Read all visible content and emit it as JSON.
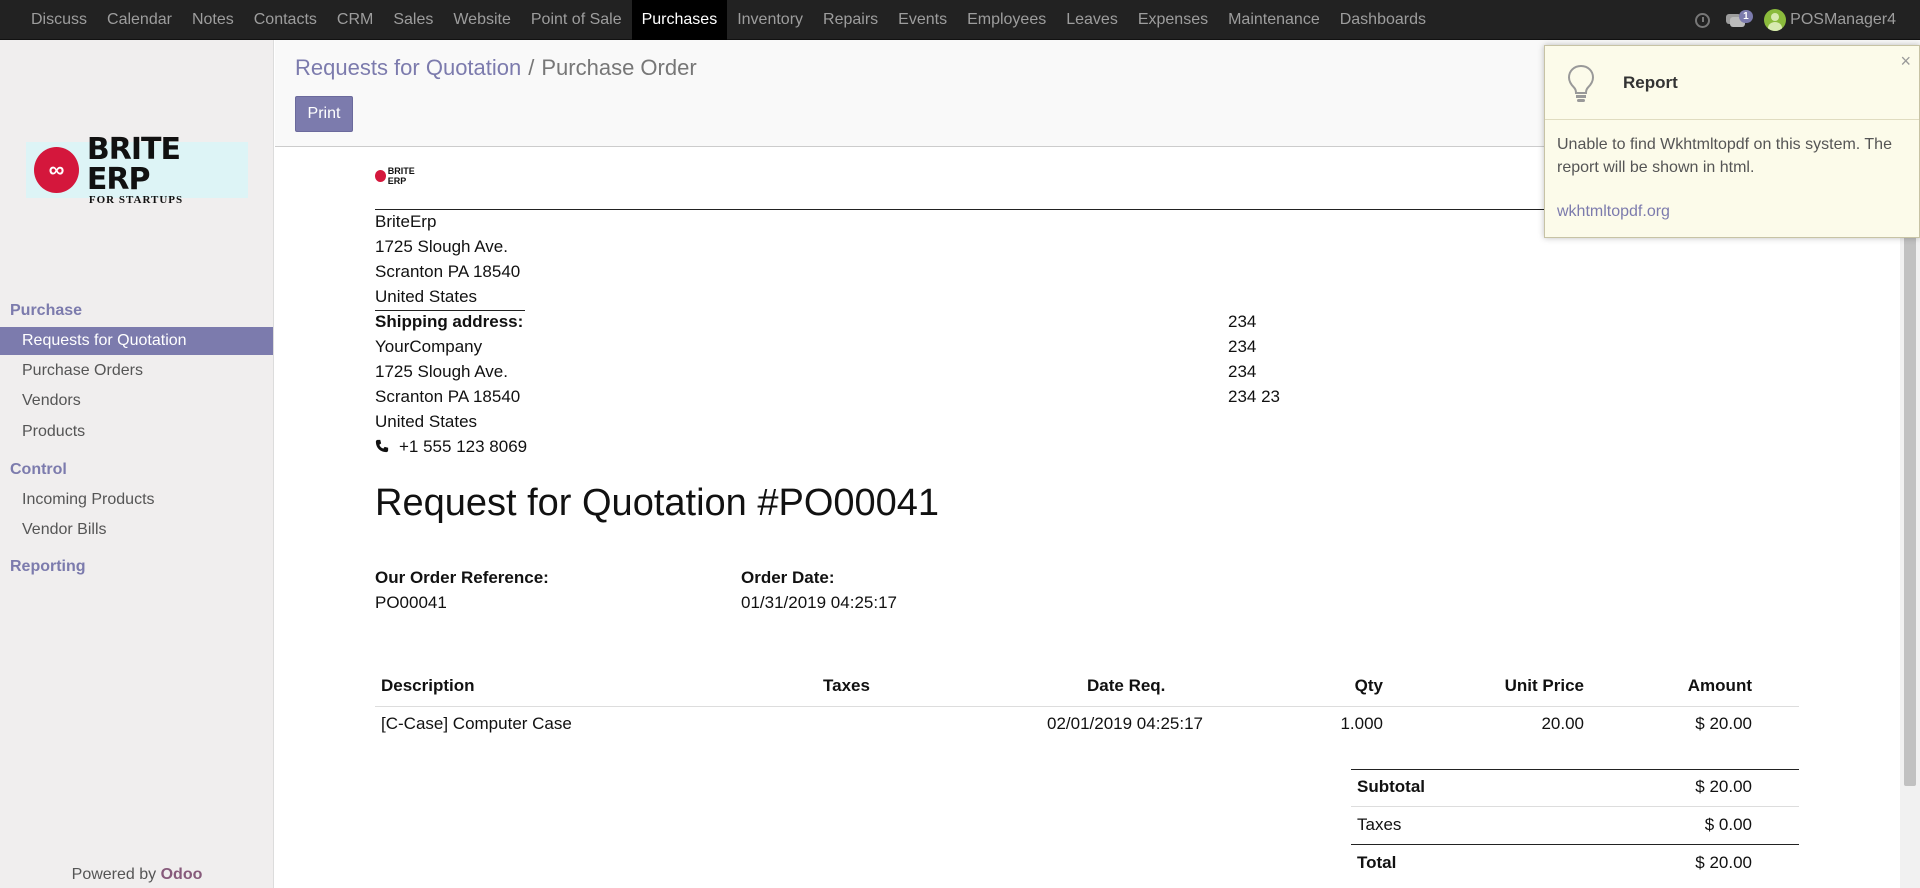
{
  "topbar": {
    "menu": [
      "Discuss",
      "Calendar",
      "Notes",
      "Contacts",
      "CRM",
      "Sales",
      "Website",
      "Point of Sale",
      "Purchases",
      "Inventory",
      "Repairs",
      "Events",
      "Employees",
      "Leaves",
      "Expenses",
      "Maintenance",
      "Dashboards"
    ],
    "active": "Purchases",
    "chat_badge": "1",
    "user": "POSManager4"
  },
  "logo": {
    "line1": "BRITE ERP",
    "line2": "FOR STARTUPS",
    "mini": "BRITE ERP"
  },
  "sidebar": {
    "sections": [
      {
        "title": "Purchase",
        "items": [
          "Requests for Quotation",
          "Purchase Orders",
          "Vendors",
          "Products"
        ]
      },
      {
        "title": "Control",
        "items": [
          "Incoming Products",
          "Vendor Bills"
        ]
      },
      {
        "title": "Reporting",
        "items": []
      }
    ],
    "active_item": "Requests for Quotation",
    "powered_prefix": "Powered by",
    "powered_brand": "Odoo"
  },
  "breadcrumb": {
    "parent": "Requests for Quotation",
    "separator": "/",
    "current": "Purchase Order"
  },
  "buttons": {
    "print": "Print"
  },
  "report": {
    "company": {
      "name": "BriteErp",
      "street": "1725 Slough Ave.",
      "city": "Scranton PA 18540",
      "country": "United States"
    },
    "shipping_label": "Shipping address:",
    "shipping": {
      "name": "YourCompany",
      "street": "1725 Slough Ave.",
      "city": "Scranton PA 18540",
      "country": "United States",
      "phone": "+1 555 123 8069"
    },
    "vendor": [
      "234",
      "234",
      "234",
      "234 23"
    ],
    "title": "Request for Quotation #PO00041",
    "order_ref_label": "Our Order Reference:",
    "order_ref": "PO00041",
    "order_date_label": "Order Date:",
    "order_date": "01/31/2019 04:25:17",
    "table": {
      "headers": {
        "description": "Description",
        "taxes": "Taxes",
        "date_req": "Date Req.",
        "qty": "Qty",
        "unit_price": "Unit Price",
        "amount": "Amount"
      },
      "row": {
        "description": "[C-Case] Computer Case",
        "taxes": "",
        "date_req": "02/01/2019 04:25:17",
        "qty": "1.000",
        "unit_price": "20.00",
        "amount": "$ 20.00"
      }
    },
    "totals": {
      "subtotal_label": "Subtotal",
      "subtotal": "$ 20.00",
      "taxes_label": "Taxes",
      "taxes": "$ 0.00",
      "total_label": "Total",
      "total": "$ 20.00"
    }
  },
  "notification": {
    "title": "Report",
    "close": "×",
    "message": "Unable to find Wkhtmltopdf on this system. The report will be shown in html.",
    "link": "wkhtmltopdf.org"
  }
}
